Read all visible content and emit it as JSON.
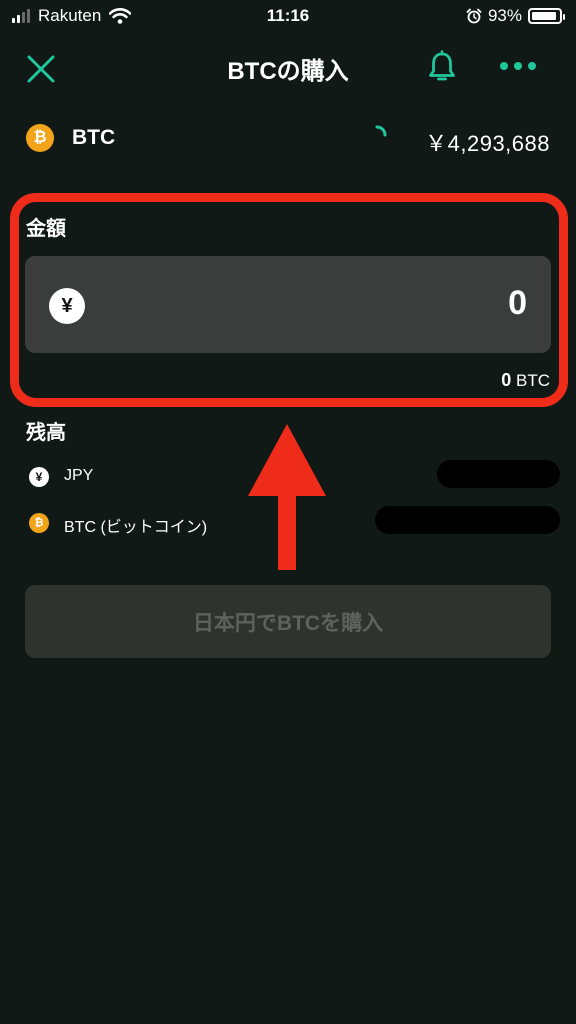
{
  "status_bar": {
    "carrier": "Rakuten",
    "time": "11:16",
    "battery": "93%",
    "battery_level": 0.93
  },
  "header": {
    "title": "BTCの購入",
    "close_icon": "close-icon",
    "bell_icon": "bell-icon",
    "more_icon": "more-dots-icon"
  },
  "asset": {
    "coin_symbol": "₿",
    "name": "BTC",
    "price": "￥4,293,688"
  },
  "amount": {
    "label": "金額",
    "currency_symbol": "¥",
    "value": "0",
    "converted_value": "0",
    "converted_unit": "BTC"
  },
  "balance": {
    "label": "残高",
    "items": [
      {
        "coin_symbol": "¥",
        "name": "JPY"
      },
      {
        "coin_symbol": "₿",
        "name": "BTC (ビットコイン)"
      }
    ]
  },
  "buy_button": {
    "label": "日本円でBTCを購入"
  },
  "colors": {
    "background": "#101916",
    "accent_green": "#1fc79a",
    "btc_orange": "#f2a41a",
    "highlight_red": "#ef2b1a",
    "input_bg": "#3a3d3b",
    "button_disabled_bg": "#2f3330",
    "button_disabled_text": "#5d625f"
  }
}
